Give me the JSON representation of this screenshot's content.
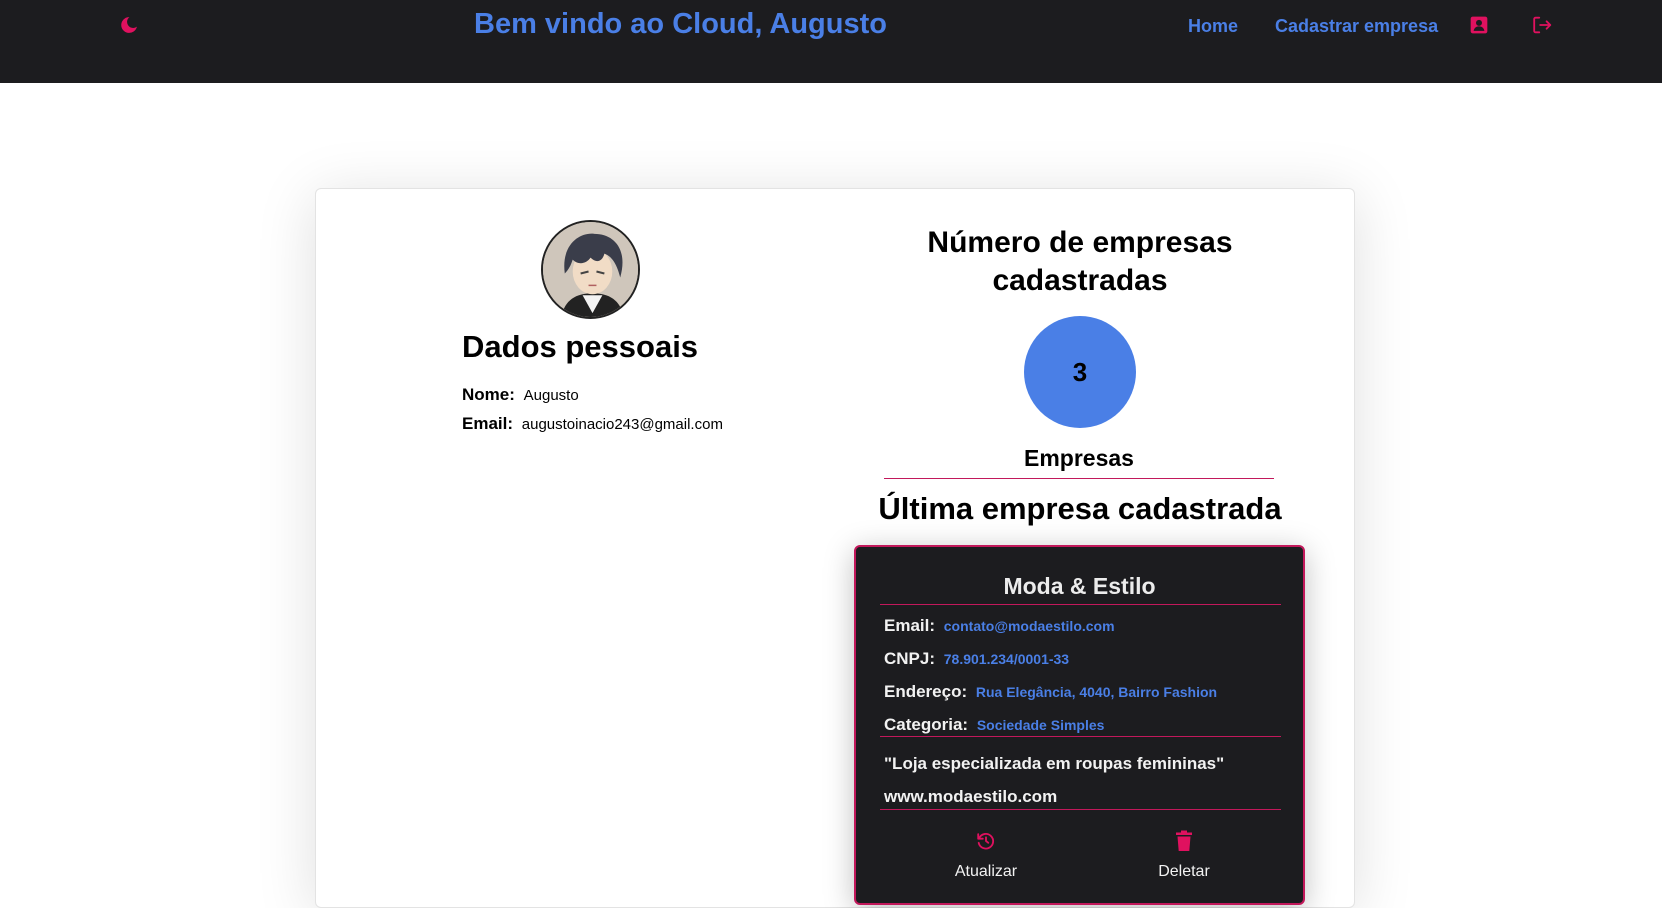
{
  "header": {
    "title": "Bem vindo ao Cloud, Augusto",
    "nav": {
      "home": "Home",
      "register_company": "Cadastrar empresa"
    },
    "icons": {
      "theme": "moon-icon",
      "profile": "user-card-icon",
      "logout": "logout-icon"
    }
  },
  "profile": {
    "title": "Dados pessoais",
    "name_label": "Nome:",
    "name_value": "Augusto",
    "email_label": "Email:",
    "email_value": "augustoinacio243@gmail.com"
  },
  "stats": {
    "title": "Número de empresas cadastradas",
    "count": "3",
    "count_label": "Empresas"
  },
  "last_company": {
    "section_title": "Última empresa cadastrada",
    "name": "Moda & Estilo",
    "email_label": "Email:",
    "email_value": "contato@modaestilo.com",
    "cnpj_label": "CNPJ:",
    "cnpj_value": "78.901.234/0001-33",
    "address_label": "Endereço:",
    "address_value": "Rua Elegância, 4040, Bairro Fashion",
    "category_label": "Categoria:",
    "category_value": "Sociedade Simples",
    "description": "\"Loja especializada em roupas femininas\"",
    "website": "www.modaestilo.com",
    "actions": {
      "update": "Atualizar",
      "delete": "Deletar"
    }
  },
  "colors": {
    "accent_blue": "#4a7fe6",
    "accent_pink": "#c2185b",
    "dark_bg": "#1c1c1f"
  }
}
